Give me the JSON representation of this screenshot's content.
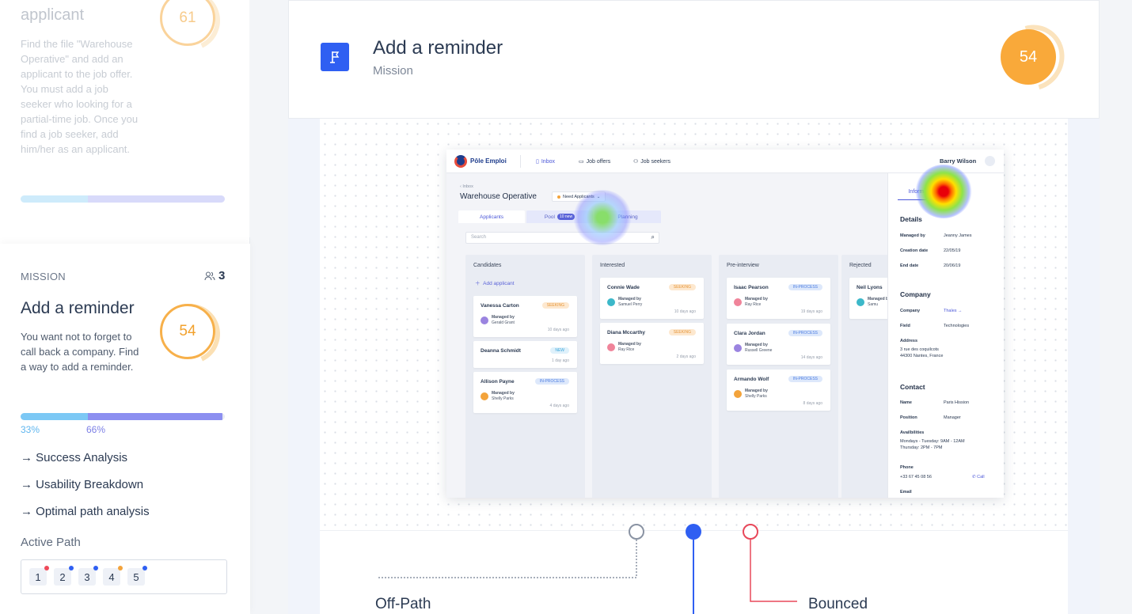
{
  "previous_card": {
    "title": "applicant",
    "score": "61",
    "description": "Find the file \"Warehouse Operative\" and add an applicant to the job offer. You must add a job seeker who looking for a partial-time job. Once you find a job seeker, add him/her as an applicant."
  },
  "mission_card": {
    "label": "MISSION",
    "user_count": "3",
    "title": "Add a reminder",
    "description": "You want not to forget to call back a company. Find a way to add a reminder.",
    "score": "54",
    "success_pct": "33%",
    "fail_pct": "66%",
    "links": [
      "→ Success Analysis",
      "→ Usability Breakdown",
      "→ Optimal path analysis"
    ],
    "active_path_label": "Active Path",
    "steps": [
      {
        "n": "1",
        "color": "#ef4a5a"
      },
      {
        "n": "2",
        "color": "#2f5ff2"
      },
      {
        "n": "3",
        "color": "#2f5ff2"
      },
      {
        "n": "4",
        "color": "#f3a33b"
      },
      {
        "n": "5",
        "color": "#2f5ff2"
      }
    ]
  },
  "header": {
    "title": "Add a reminder",
    "subtitle": "Mission",
    "score": "54"
  },
  "shot": {
    "brand": "Pôle Emploi",
    "nav": [
      "Inbox",
      "Job offers",
      "Job seekers"
    ],
    "user": "Barry Wilson",
    "crumb": "‹  Inbox",
    "title": "Warehouse Operative",
    "status": "Need Applicants",
    "tabs": [
      "Applicants",
      "Pool",
      "Planning"
    ],
    "pool_badge": "10 new",
    "search_placeholder": "Search",
    "columns": [
      {
        "title": "Candidates",
        "add": "Add applicant",
        "cards": [
          {
            "name": "Vanessa Carton",
            "tag": "SEEKING",
            "manager": "Gerald Grant",
            "time": "10 days ago"
          },
          {
            "name": "Deanna Schmidt",
            "tag": "NEW",
            "manager": "",
            "time": "1 day ago"
          },
          {
            "name": "Allison Payne",
            "tag": "IN-PROCESS",
            "manager": "Shelly Parks",
            "time": "4 days ago"
          }
        ]
      },
      {
        "title": "Interested",
        "cards": [
          {
            "name": "Connie Wade",
            "tag": "SEEKING",
            "manager": "Samuel Perry",
            "time": "10 days ago"
          },
          {
            "name": "Diana Mccarthy",
            "tag": "SEEKING",
            "manager": "Ray Rice",
            "time": "2 days ago"
          }
        ]
      },
      {
        "title": "Pre-interview",
        "cards": [
          {
            "name": "Isaac Pearson",
            "tag": "IN-PROCESS",
            "manager": "Ray Rice",
            "time": "19 days ago"
          },
          {
            "name": "Clara Jordan",
            "tag": "IN-PROCESS",
            "manager": "Russell Greene",
            "time": "14 days ago"
          },
          {
            "name": "Armando Wolf",
            "tag": "IN-PROCESS",
            "manager": "Shelly Parks",
            "time": "8 days ago"
          }
        ]
      },
      {
        "title": "Rejected",
        "cards": [
          {
            "name": "Neil Lyons",
            "tag": "",
            "manager": "Samu",
            "time": ""
          }
        ]
      }
    ],
    "managed_by": "Managed by",
    "panel": {
      "tab": "Information",
      "details_title": "Details",
      "details": [
        {
          "k": "Managed by",
          "v": "Jeanny James"
        },
        {
          "k": "Creation date",
          "v": "22/05/19"
        },
        {
          "k": "End date",
          "v": "20/06/19"
        }
      ],
      "company_title": "Company",
      "company": [
        {
          "k": "Company",
          "v": "Thales →"
        },
        {
          "k": "Field",
          "v": "Technologies"
        }
      ],
      "address_label": "Address",
      "address": "3 rue des coquilcots\n44300 Nantes, France",
      "contact_title": "Contact",
      "contact": [
        {
          "k": "Name",
          "v": "Paris Hission"
        },
        {
          "k": "Position",
          "v": "Manager"
        }
      ],
      "avail_label": "Availbilities",
      "avail": "Mondays - Tuesday: 9AM - 12AM\nThursday: 2PM - 7PM",
      "phone_label": "Phone",
      "phone": "+33 67 45 08 56",
      "call": "Call",
      "email_label": "Email"
    }
  },
  "paths": {
    "off_path": "Off-Path",
    "bounced": "Bounced"
  },
  "colors": {
    "accent": "#2f5ff2",
    "score": "#f9a93a",
    "bounced": "#e8485a"
  }
}
